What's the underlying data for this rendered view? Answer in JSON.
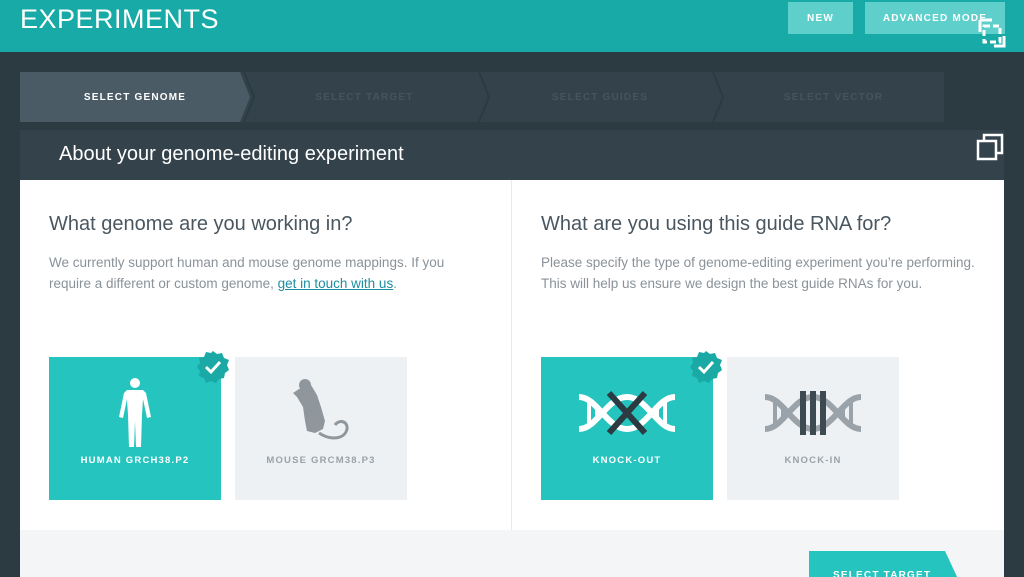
{
  "header": {
    "title": "EXPERIMENTS",
    "new_label": "NEW",
    "advanced_label": "ADVANCED MODE"
  },
  "steps": [
    {
      "label": "SELECT GENOME",
      "active": true
    },
    {
      "label": "SELECT TARGET",
      "active": false
    },
    {
      "label": "SELECT GUIDES",
      "active": false
    },
    {
      "label": "SELECT VECTOR",
      "active": false
    }
  ],
  "panel": {
    "title": "About your genome-editing experiment"
  },
  "genome": {
    "heading": "What genome are you working in?",
    "desc_before": "We currently support human and mouse genome mappings. If you require a different or custom genome, ",
    "link": "get in touch with us",
    "desc_after": ".",
    "options": [
      {
        "label": "HUMAN GRCH38.P2",
        "icon": "human-figure-icon",
        "selected": true
      },
      {
        "label": "MOUSE GRCM38.P3",
        "icon": "mouse-icon",
        "selected": false
      }
    ]
  },
  "guide": {
    "heading": "What are you using this guide RNA for?",
    "desc": "Please specify the type of genome-editing experiment you’re performing. This will help us ensure we design the best guide RNAs for you.",
    "options": [
      {
        "label": "KNOCK-OUT",
        "icon": "dna-knockout-icon",
        "selected": true
      },
      {
        "label": "KNOCK-IN",
        "icon": "dna-knockin-icon",
        "selected": false
      }
    ]
  },
  "footer": {
    "next_label": "SELECT TARGET"
  },
  "colors": {
    "accent": "#26c4bf",
    "topbar": "#17aaa6",
    "dark": "#2c3a42"
  }
}
